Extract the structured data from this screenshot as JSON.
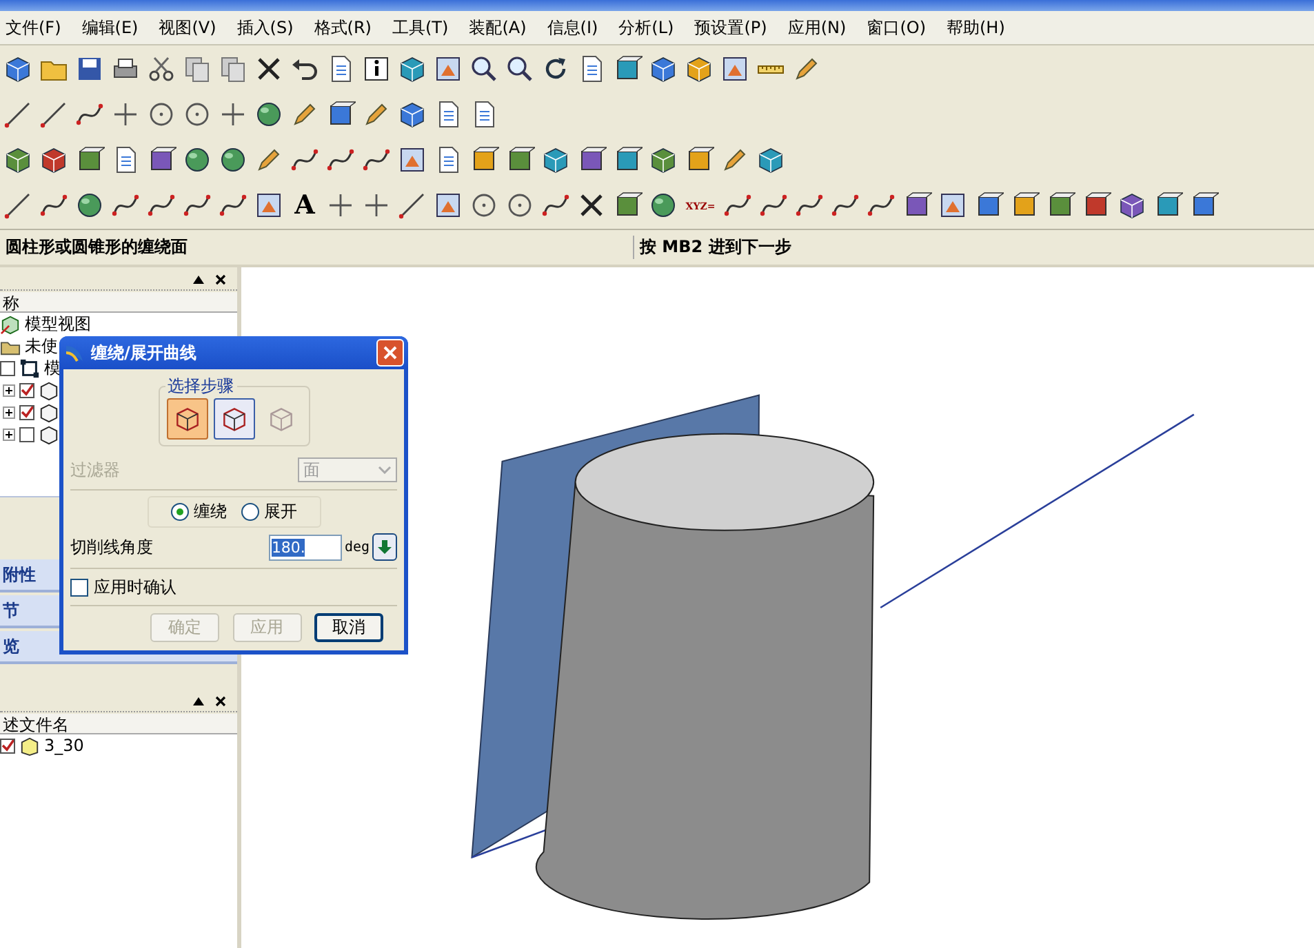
{
  "menu": [
    "文件(F)",
    "编辑(E)",
    "视图(V)",
    "插入(S)",
    "格式(R)",
    "工具(T)",
    "装配(A)",
    "信息(I)",
    "分析(L)",
    "预设置(P)",
    "应用(N)",
    "窗口(O)",
    "帮助(H)"
  ],
  "toolbar_glyphs": [
    "A",
    "XYZ="
  ],
  "status_bar": {
    "prompt": "圆柱形或圆锥形的缠绕面",
    "hint": "按 MB2 进到下一步"
  },
  "navigator": {
    "column": "称",
    "tree": [
      {
        "label": "模型视图",
        "kind": "view"
      },
      {
        "label": "未使",
        "kind": "folder"
      },
      {
        "label": "模",
        "kind": "model",
        "checked": false,
        "children": [
          {
            "checked": true,
            "expanded": false
          },
          {
            "checked": true,
            "expanded": false
          },
          {
            "checked": false,
            "expanded": false
          }
        ]
      }
    ],
    "sections": [
      "附性",
      "节",
      "览"
    ]
  },
  "files_panel": {
    "column": "述文件名",
    "rows": [
      {
        "label": "3_30",
        "checked": true
      }
    ]
  },
  "dialog": {
    "title": "缠绕/展开曲线",
    "step_group": "选择步骤",
    "steps": [
      {
        "selected": true,
        "disabled": false
      },
      {
        "selected": false,
        "disabled": false
      },
      {
        "selected": false,
        "disabled": true
      }
    ],
    "filter": {
      "label": "过滤器",
      "value": "面",
      "disabled": true
    },
    "modes": [
      {
        "label": "缠绕",
        "selected": true
      },
      {
        "label": "展开",
        "selected": false
      }
    ],
    "angle": {
      "label": "切削线角度",
      "value": "180.",
      "unit": "deg"
    },
    "confirm": {
      "label": "应用时确认",
      "checked": false
    },
    "buttons": [
      {
        "label": "确定",
        "disabled": true
      },
      {
        "label": "应用",
        "disabled": true
      },
      {
        "label": "取消",
        "disabled": false
      }
    ]
  }
}
